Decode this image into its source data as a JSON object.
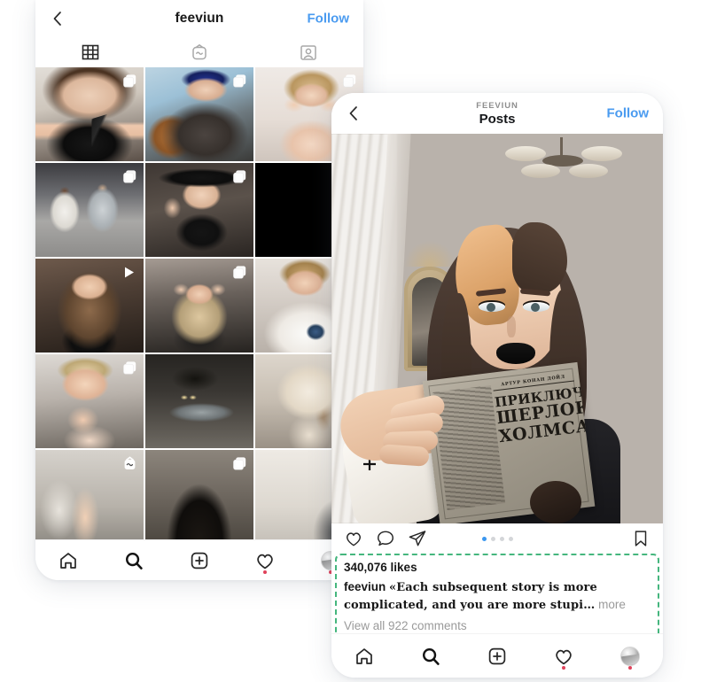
{
  "profile_phone": {
    "header": {
      "back_icon": "chevron-left-icon",
      "username": "feeviun",
      "follow_label": "Follow"
    },
    "tabs": [
      {
        "name": "grid-tab",
        "icon": "grid-icon",
        "active": true
      },
      {
        "name": "igtv-tab",
        "icon": "igtv-icon",
        "active": false
      },
      {
        "name": "tagged-tab",
        "icon": "tagged-person-icon",
        "active": false
      }
    ],
    "grid": {
      "columns": 3,
      "cells": [
        {
          "id": "post-1",
          "badge": "multi-photo-icon",
          "alt": "woman in glasses holding a pistol"
        },
        {
          "id": "post-2",
          "badge": "multi-photo-icon",
          "alt": "woman in blue beanie leaning on hand"
        },
        {
          "id": "post-3",
          "badge": "multi-photo-icon",
          "alt": "blonde woman hands on cheeks"
        },
        {
          "id": "post-4",
          "badge": "multi-photo-icon",
          "alt": "two people sitting on floor in tracksuits"
        },
        {
          "id": "post-5",
          "badge": "multi-photo-icon",
          "alt": "woman in black wide-brim hat"
        },
        {
          "id": "post-6",
          "badge": "none",
          "alt": "black photo"
        },
        {
          "id": "post-7",
          "badge": "play-icon",
          "alt": "woman with long hair video"
        },
        {
          "id": "post-8",
          "badge": "multi-photo-icon",
          "alt": "blonde woman hands raised"
        },
        {
          "id": "post-9",
          "badge": "none",
          "alt": "woman in white graphic tee"
        },
        {
          "id": "post-10",
          "badge": "multi-photo-icon",
          "alt": "blonde woman hand on chin"
        },
        {
          "id": "post-11",
          "badge": "none",
          "alt": "night street with parked car"
        },
        {
          "id": "post-12",
          "badge": "none",
          "alt": "woman in cream hoodie"
        },
        {
          "id": "post-13",
          "badge": "igtv-icon",
          "alt": "woman indoors partial"
        },
        {
          "id": "post-14",
          "badge": "multi-photo-icon",
          "alt": "top of head dark hair partial"
        },
        {
          "id": "post-15",
          "badge": "none",
          "alt": "light room partial"
        }
      ]
    },
    "nav": [
      {
        "name": "home",
        "icon": "home-icon",
        "dot": false
      },
      {
        "name": "search",
        "icon": "search-icon",
        "dot": false
      },
      {
        "name": "create",
        "icon": "plus-box-icon",
        "dot": false
      },
      {
        "name": "activity",
        "icon": "heart-icon",
        "dot": true
      },
      {
        "name": "profile",
        "icon": "avatar-icon",
        "dot": true
      }
    ]
  },
  "post_phone": {
    "header": {
      "back_icon": "chevron-left-icon",
      "kicker": "FEEVIUN",
      "title": "Posts",
      "follow_label": "Follow"
    },
    "media": {
      "alt": "woman with black lipstick holding a vintage book",
      "book_title_lines": [
        "АРТУР КОНАН ДОЙЛ",
        "ПРИКЛЮЧЕНИЯ",
        "ШЕРЛОКА",
        "ХОЛМСА"
      ]
    },
    "actions": {
      "like_icon": "heart-icon",
      "comment_icon": "comment-bubble-icon",
      "share_icon": "paper-plane-icon",
      "save_icon": "bookmark-icon",
      "carousel_dots": 4,
      "carousel_active_index": 0
    },
    "caption": {
      "likes": "340,076 likes",
      "username": "feeviun",
      "text": "«Each subsequent story is more complicated, and you are more stupi",
      "more_label": "more",
      "comments_label": "View all 922 comments"
    },
    "nav": [
      {
        "name": "home",
        "icon": "home-icon",
        "dot": false
      },
      {
        "name": "search",
        "icon": "search-icon",
        "dot": false
      },
      {
        "name": "create",
        "icon": "plus-box-icon",
        "dot": false
      },
      {
        "name": "activity",
        "icon": "heart-icon",
        "dot": true
      },
      {
        "name": "profile",
        "icon": "avatar-icon",
        "dot": true
      }
    ]
  },
  "colors": {
    "accent_blue": "#4a9bf0",
    "highlight_green": "#45b67e",
    "dot_active": "#3b97ef",
    "notification_red": "#e0415a",
    "text_primary": "#181818",
    "text_muted": "#9a9a9a"
  }
}
